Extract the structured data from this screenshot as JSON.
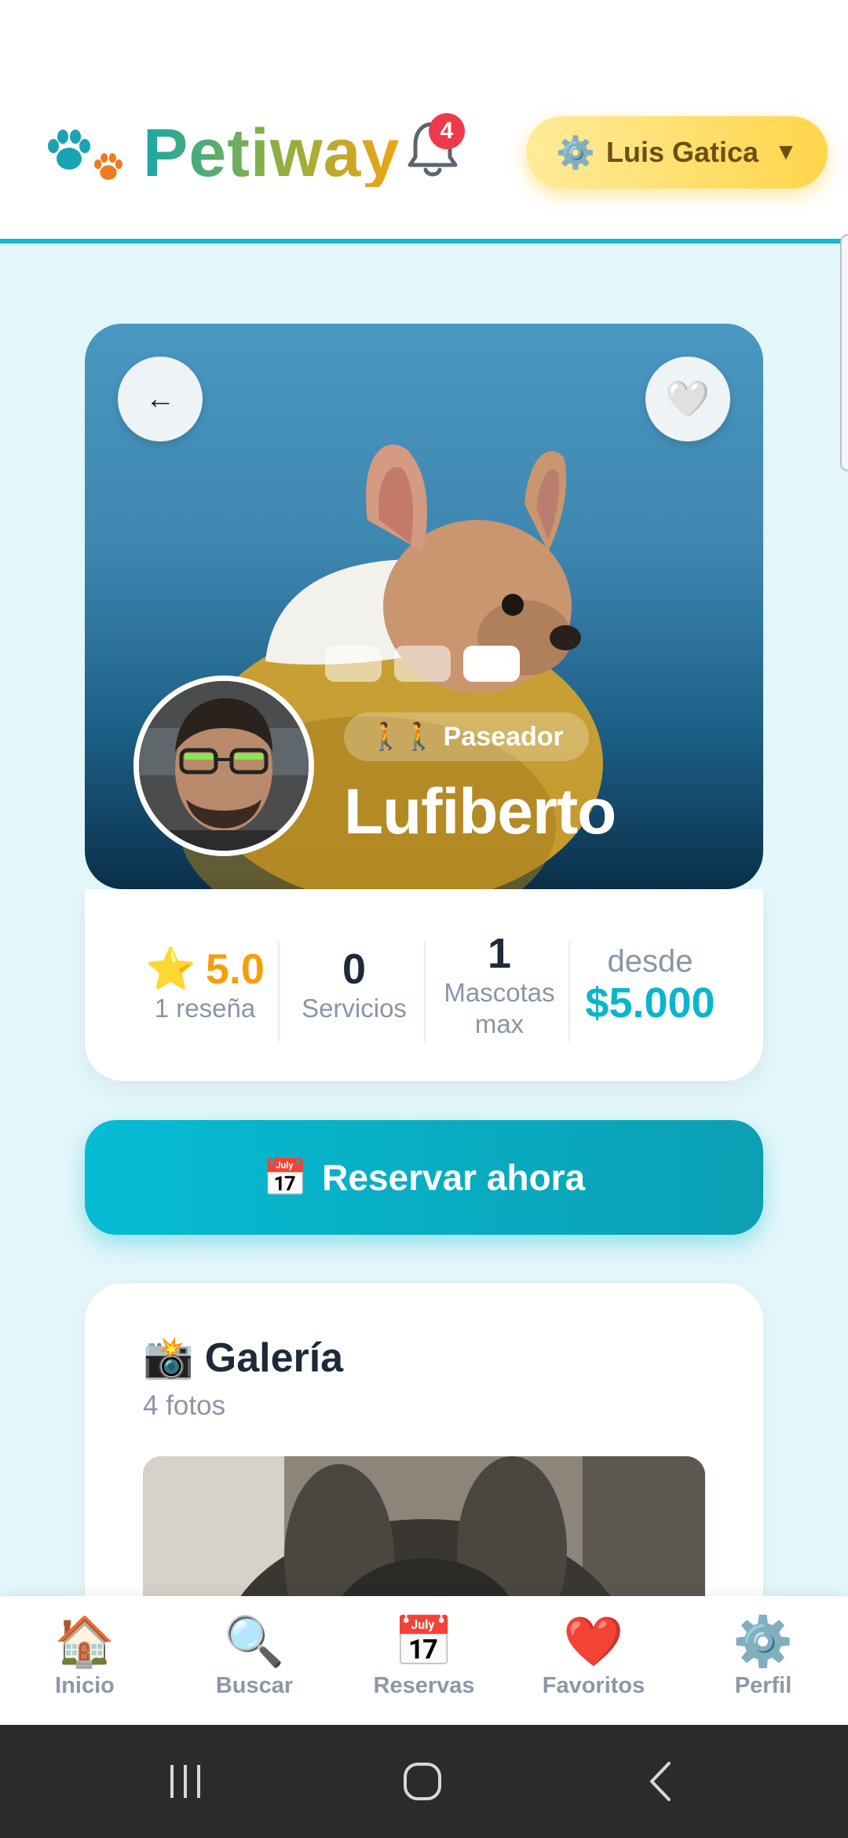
{
  "header": {
    "app_name": "Petiway",
    "notification_count": "4",
    "user_name": "Luis Gatica",
    "user_icon": "gear-icon",
    "dropdown_arrow": "▼"
  },
  "hero": {
    "back_arrow": "←",
    "favorite_symbol": "🤍",
    "role_icons": "🚶🚶",
    "role_label": "Paseador",
    "pet_name": "Lufiberto",
    "photo_count": 3,
    "active_photo": 3
  },
  "stats": {
    "rating_value": "5.0",
    "rating_label": "1 reseña",
    "services_value": "0",
    "services_label": "Servicios",
    "max_pets_value": "1",
    "max_pets_label": "Mascotas max",
    "price_prefix": "desde",
    "price_value": "$5.000"
  },
  "cta": {
    "icon": "📅",
    "label": "Reservar ahora"
  },
  "gallery": {
    "icon": "📸",
    "title": "Galería",
    "count_label": "4 fotos"
  },
  "bottom_nav": {
    "items": [
      {
        "icon": "🏠",
        "label": "Inicio"
      },
      {
        "icon": "🔍",
        "label": "Buscar"
      },
      {
        "icon": "📅",
        "label": "Reservas"
      },
      {
        "icon": "❤️",
        "label": "Favoritos"
      },
      {
        "icon": "⚙️",
        "label": "Perfil"
      }
    ]
  },
  "colors": {
    "accent": "#06bcd4",
    "price": "#0bb5cc",
    "rating": "#f59e0b",
    "badge": "#ef3a4b"
  }
}
